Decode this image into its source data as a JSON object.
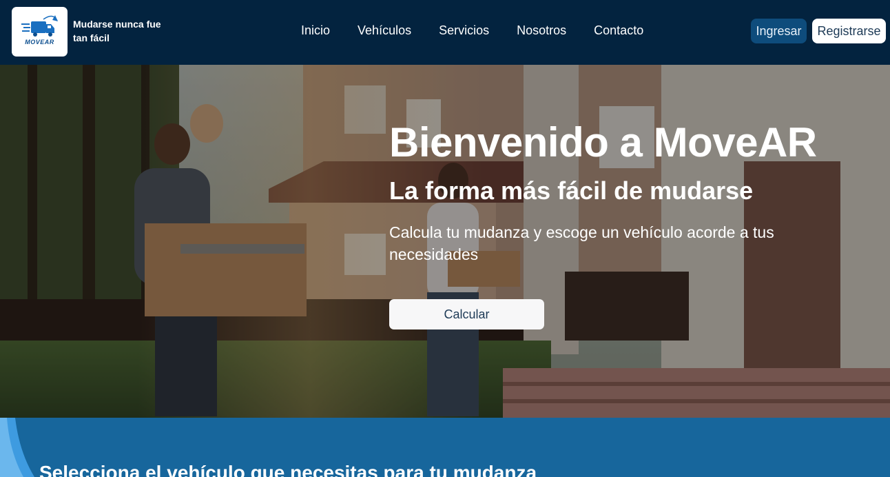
{
  "brand": {
    "logo_text": "MOVEAR",
    "tagline": "Mudarse nunca fue tan fácil",
    "color": "#0d4f8f"
  },
  "nav": {
    "links": [
      "Inicio",
      "Vehículos",
      "Servicios",
      "Nosotros",
      "Contacto"
    ]
  },
  "auth": {
    "login_label": "Ingresar",
    "register_label": "Registrarse"
  },
  "hero": {
    "title": "Bienvenido a MoveAR",
    "subtitle": "La forma más fácil de mudarse",
    "description": "Calcula tu mudanza y escoge un vehículo acorde a tus necesidades",
    "cta_label": "Calcular"
  },
  "vehicles_section": {
    "title": "Selecciona el vehículo que necesitas para tu mudanza"
  },
  "colors": {
    "navbar_bg": "#03233f",
    "login_bg": "#0e4c7c",
    "section_bg": "#17669c"
  },
  "icons": {
    "logo": "moving-truck-icon"
  }
}
